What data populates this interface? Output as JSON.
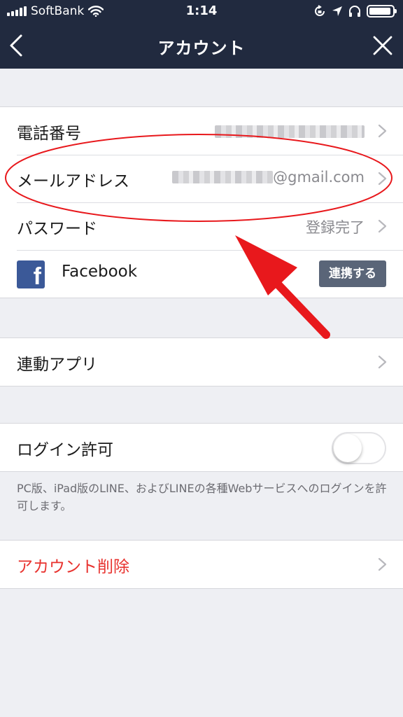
{
  "status_bar": {
    "carrier": "SoftBank",
    "time": "1:14"
  },
  "nav": {
    "title": "アカウント"
  },
  "account": {
    "phone_label": "電話番号",
    "email_label": "メールアドレス",
    "email_suffix": "@gmail.com",
    "password_label": "パスワード",
    "password_value": "登録完了",
    "facebook_label": "Facebook",
    "facebook_button": "連携する"
  },
  "linked_apps": {
    "label": "連動アプリ"
  },
  "login": {
    "label": "ログイン許可",
    "enabled": false,
    "note": "PC版、iPad版のLINE、およびLINEの各種Webサービスへのログインを許可します。"
  },
  "delete": {
    "label": "アカウント削除"
  },
  "colors": {
    "nav_bg": "#212a3f",
    "annotation_red": "#e8181c",
    "danger_text": "#e8332f",
    "button_bg": "#5a6578",
    "facebook_blue": "#3b5998"
  },
  "icons": [
    "signal-icon",
    "wifi-icon",
    "back-icon",
    "close-icon",
    "chevron-right-icon",
    "facebook-icon",
    "battery-icon"
  ]
}
